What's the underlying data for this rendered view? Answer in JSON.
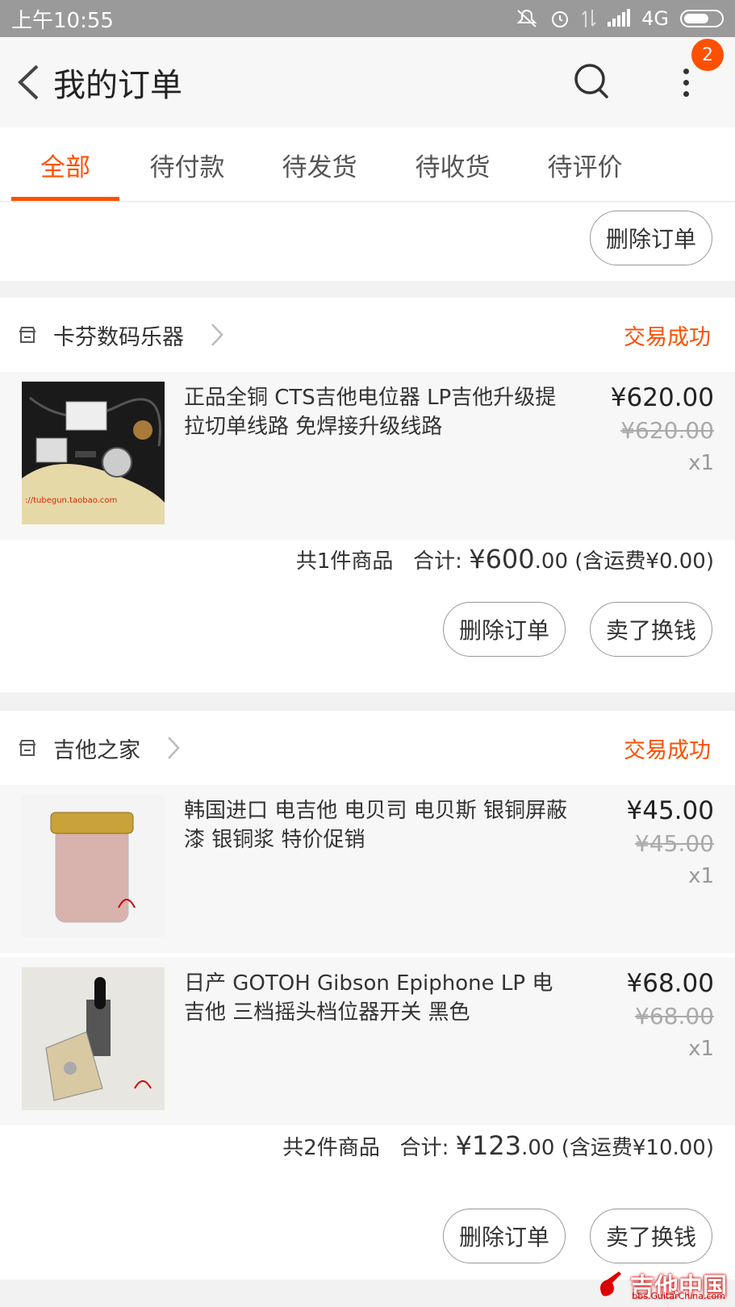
{
  "status_bar": {
    "time": "上午10:55",
    "network": "4G"
  },
  "header": {
    "title": "我的订单",
    "badge_count": "2"
  },
  "tabs": [
    {
      "label": "全部",
      "active": true
    },
    {
      "label": "待付款"
    },
    {
      "label": "待发货"
    },
    {
      "label": "待收货"
    },
    {
      "label": "待评价"
    }
  ],
  "top_partial": {
    "delete_label": "删除订单"
  },
  "orders": [
    {
      "shop": "卡芬数码乐器",
      "status": "交易成功",
      "items": [
        {
          "title": "正品全铜 CTS吉他电位器 LP吉他升级提拉切单线路 免焊接升级线路",
          "price": "¥620.00",
          "orig_price": "¥620.00",
          "qty": "x1",
          "thumb_caption": "://tubegun.taobao.com"
        }
      ],
      "summary": {
        "count_text": "共1件商品",
        "total_label": "合计:",
        "total_main": "¥600",
        "total_dec": ".00",
        "shipping": "(含运费¥0.00)"
      },
      "buttons": [
        "删除订单",
        "卖了换钱"
      ]
    },
    {
      "shop": "吉他之家",
      "status": "交易成功",
      "items": [
        {
          "title": "韩国进口 电吉他 电贝司 电贝斯 银铜屏蔽漆 银铜浆 特价促销",
          "price": "¥45.00",
          "orig_price": "¥45.00",
          "qty": "x1"
        },
        {
          "title": "日产 GOTOH Gibson Epiphone LP 电吉他 三档摇头档位器开关 黑色",
          "price": "¥68.00",
          "orig_price": "¥68.00",
          "qty": "x1"
        }
      ],
      "summary": {
        "count_text": "共2件商品",
        "total_label": "合计:",
        "total_main": "¥123",
        "total_dec": ".00",
        "shipping": "(含运费¥10.00)"
      },
      "buttons": [
        "删除订单",
        "卖了换钱"
      ]
    }
  ],
  "watermark": {
    "main": "吉他中国",
    "sub": "bbs.GuitarChina.com"
  },
  "colors": {
    "accent": "#ff5000",
    "status_bar": "#9a9a9a",
    "page_bg": "#f2f2f2",
    "item_bg": "#f7f7f7"
  }
}
